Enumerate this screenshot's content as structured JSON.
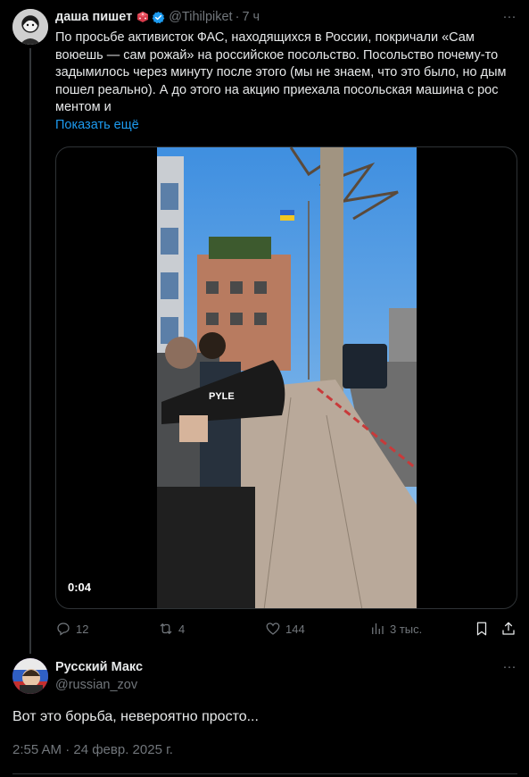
{
  "tweet": {
    "author_name": "даша пишет",
    "handle": "@Tihilpiket",
    "separator": "·",
    "time": "7 ч",
    "text": "По просьбе активисток ФАС, находящихся в России, покричали «Сам воюешь — сам рожай» на российское посольство. Посольство почему-то задымилось через минуту после этого (мы не знаем, что это было, но дым пошел реально). А до этого на акцию приехала посольская машина с рос ментом и",
    "show_more": "Показать ещё",
    "video_duration": "0:04",
    "video_icons": [
      "megaphone",
      "ukraine-flag"
    ],
    "stats": {
      "replies": "12",
      "retweets": "4",
      "likes": "144",
      "views": "3 тыс."
    },
    "icons": [
      "verified-badge-icon",
      "dice-emoji-icon",
      "more-icon",
      "reply-icon",
      "retweet-icon",
      "like-icon",
      "views-icon",
      "bookmark-icon",
      "share-icon"
    ],
    "more_glyph": "···"
  },
  "reply": {
    "author_name": "Русский Макс",
    "handle": "@russian_zov",
    "text": "Вот это борьба,  невероятно просто...",
    "timestamp": "2:55 AM · 24 февр. 2025 г.",
    "more_glyph": "···"
  },
  "colors": {
    "background": "#000000",
    "text": "#e7e9ea",
    "muted": "#71767b",
    "link": "#1d9bf0",
    "border": "#2f3336"
  }
}
